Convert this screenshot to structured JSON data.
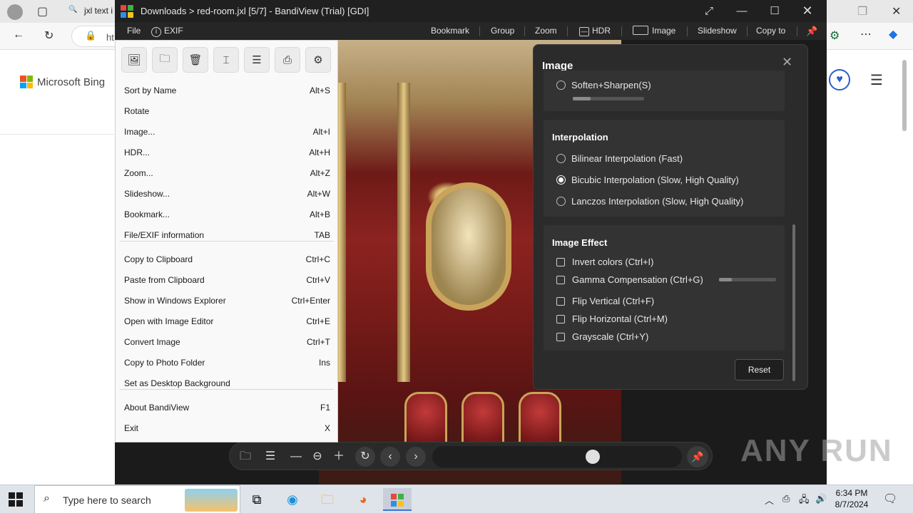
{
  "browser": {
    "tab_label": "jxl text i",
    "address_partial": "ht",
    "bing_label": "Microsoft Bing",
    "ms_colors": [
      "#f25022",
      "#7fba00",
      "#00a4ef",
      "#ffb900"
    ]
  },
  "window": {
    "title": "Downloads > red-room.jxl [5/7] - BandiView (Trial) [GDI]",
    "menu": {
      "file": "File",
      "exif": "EXIF",
      "bookmark": "Bookmark",
      "group": "Group",
      "zoom": "Zoom",
      "hdr": "HDR",
      "image": "Image",
      "slideshow": "Slideshow",
      "copy_to": "Copy to"
    }
  },
  "context_menu": {
    "tools": [
      "image-icon",
      "folder-icon",
      "trash-icon",
      "rename-icon",
      "list-icon",
      "print-icon",
      "gear-icon"
    ],
    "groups": [
      [
        {
          "label": "Sort by Name",
          "key": "Alt+S"
        },
        {
          "label": "Rotate",
          "key": ""
        },
        {
          "label": "Image...",
          "key": "Alt+I"
        },
        {
          "label": "HDR...",
          "key": "Alt+H"
        },
        {
          "label": "Zoom...",
          "key": "Alt+Z"
        },
        {
          "label": "Slideshow...",
          "key": "Alt+W"
        },
        {
          "label": "Bookmark...",
          "key": "Alt+B"
        },
        {
          "label": "File/EXIF information",
          "key": "TAB"
        }
      ],
      [
        {
          "label": "Copy to Clipboard",
          "key": "Ctrl+C"
        },
        {
          "label": "Paste from Clipboard",
          "key": "Ctrl+V"
        },
        {
          "label": "Show in Windows Explorer",
          "key": "Ctrl+Enter"
        },
        {
          "label": "Open with Image Editor",
          "key": "Ctrl+E"
        },
        {
          "label": "Convert Image",
          "key": "Ctrl+T"
        },
        {
          "label": "Copy to Photo Folder",
          "key": "Ins"
        },
        {
          "label": "Set as Desktop Background",
          "key": ""
        }
      ],
      [
        {
          "label": "About BandiView",
          "key": "F1"
        },
        {
          "label": "Exit",
          "key": "X"
        }
      ]
    ]
  },
  "image_panel": {
    "title": "Image",
    "soften_sharpen": "Soften+Sharpen(S)",
    "soften_level": 0.25,
    "interpolation": {
      "title": "Interpolation",
      "options": [
        {
          "label": "Bilinear Interpolation (Fast)",
          "selected": false
        },
        {
          "label": "Bicubic Interpolation (Slow, High Quality)",
          "selected": true
        },
        {
          "label": "Lanczos Interpolation (Slow, High Quality)",
          "selected": false
        }
      ]
    },
    "effect": {
      "title": "Image Effect",
      "invert": "Invert colors (Ctrl+I)",
      "gamma": "Gamma Compensation (Ctrl+G)",
      "gamma_level": 0.22,
      "flip_v": "Flip Vertical (Ctrl+F)",
      "flip_h": "Flip Horizontal (Ctrl+M)",
      "grayscale": "Grayscale (Ctrl+Y)"
    },
    "reset": "Reset"
  },
  "controls": {
    "seek_position": 0.65
  },
  "watermark": "ANY RUN",
  "taskbar": {
    "search_placeholder": "Type here to search",
    "time": "6:34 PM",
    "date": "8/7/2024"
  }
}
